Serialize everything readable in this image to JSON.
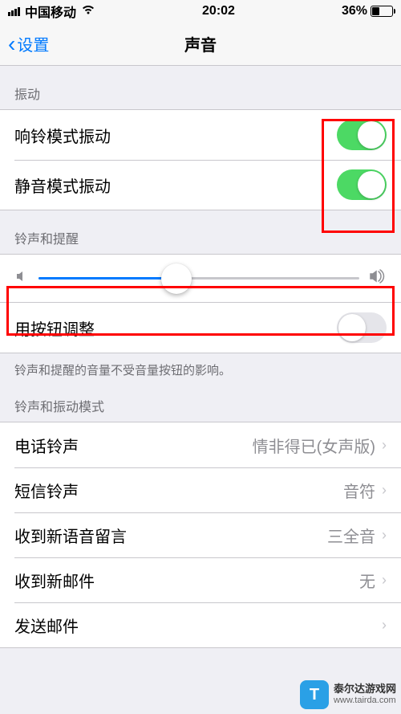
{
  "status": {
    "carrier": "中国移动",
    "time": "20:02",
    "battery_pct": "36%",
    "battery_level": 36
  },
  "nav": {
    "back_label": "设置",
    "title": "声音"
  },
  "section_vibrate": {
    "header": "振动",
    "ring_vibrate_label": "响铃模式振动",
    "ring_vibrate_on": true,
    "silent_vibrate_label": "静音模式振动",
    "silent_vibrate_on": true
  },
  "section_ringer": {
    "header": "铃声和提醒",
    "slider_value": 0.43,
    "button_adjust_label": "用按钮调整",
    "button_adjust_on": false,
    "footer": "铃声和提醒的音量不受音量按钮的影响。"
  },
  "section_patterns": {
    "header": "铃声和振动模式",
    "items": [
      {
        "label": "电话铃声",
        "value": "情非得已(女声版)"
      },
      {
        "label": "短信铃声",
        "value": "音符"
      },
      {
        "label": "收到新语音留言",
        "value": "三全音"
      },
      {
        "label": "收到新邮件",
        "value": "无"
      },
      {
        "label": "发送邮件",
        "value": ""
      }
    ]
  },
  "watermark": {
    "line1": "泰尔达游戏网",
    "line2": "www.tairda.com"
  }
}
